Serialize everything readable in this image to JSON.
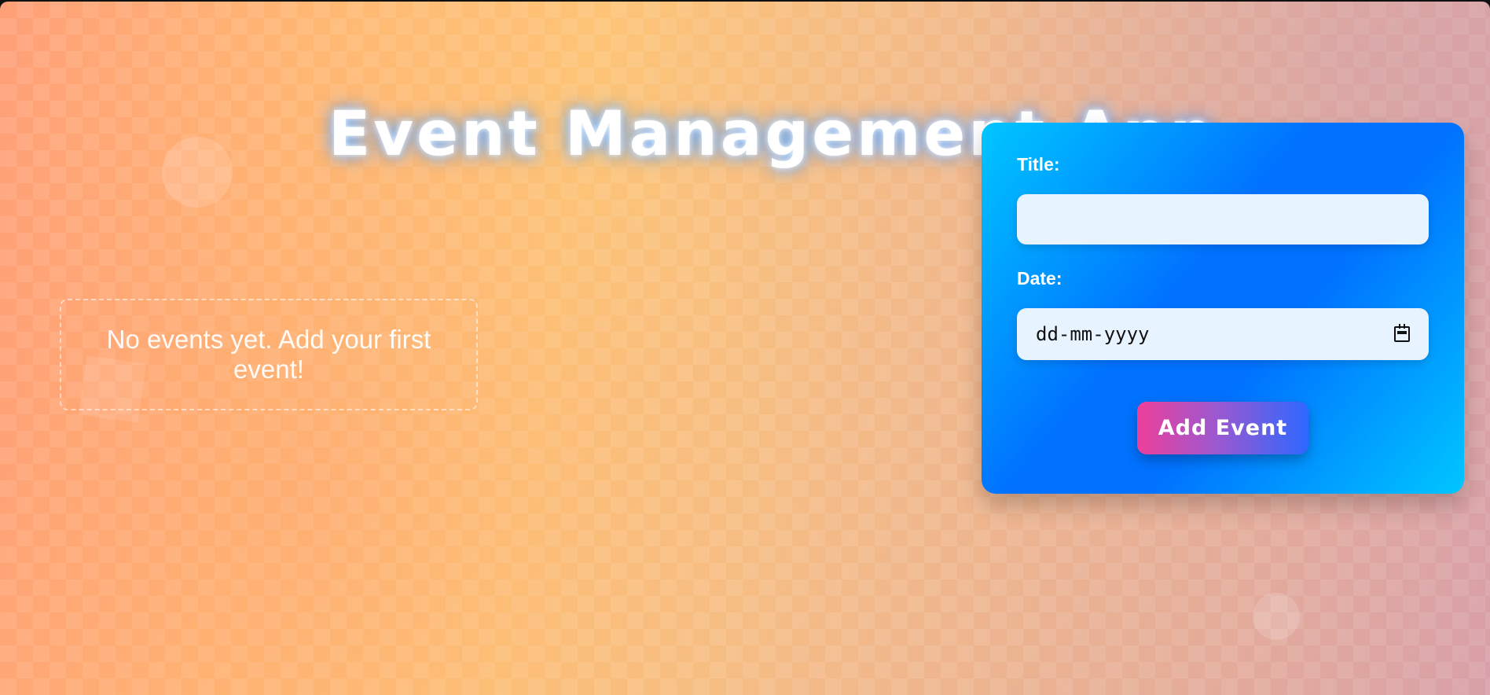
{
  "app": {
    "title": "Event Management App"
  },
  "events": {
    "empty_message": "No events yet. Add your first event!"
  },
  "form": {
    "title_label": "Title:",
    "title_value": "",
    "date_label": "Date:",
    "date_placeholder": "dd-mm-yyyy",
    "submit_label": "Add Event"
  },
  "icons": {
    "date_picker": "calendar-icon"
  },
  "colors": {
    "card_gradient_start": "#00c6ff",
    "card_gradient_mid": "#0072ff",
    "button_gradient_start": "#ee3f9b",
    "button_gradient_end": "#2d68ff",
    "input_background": "#e7f3ff"
  }
}
